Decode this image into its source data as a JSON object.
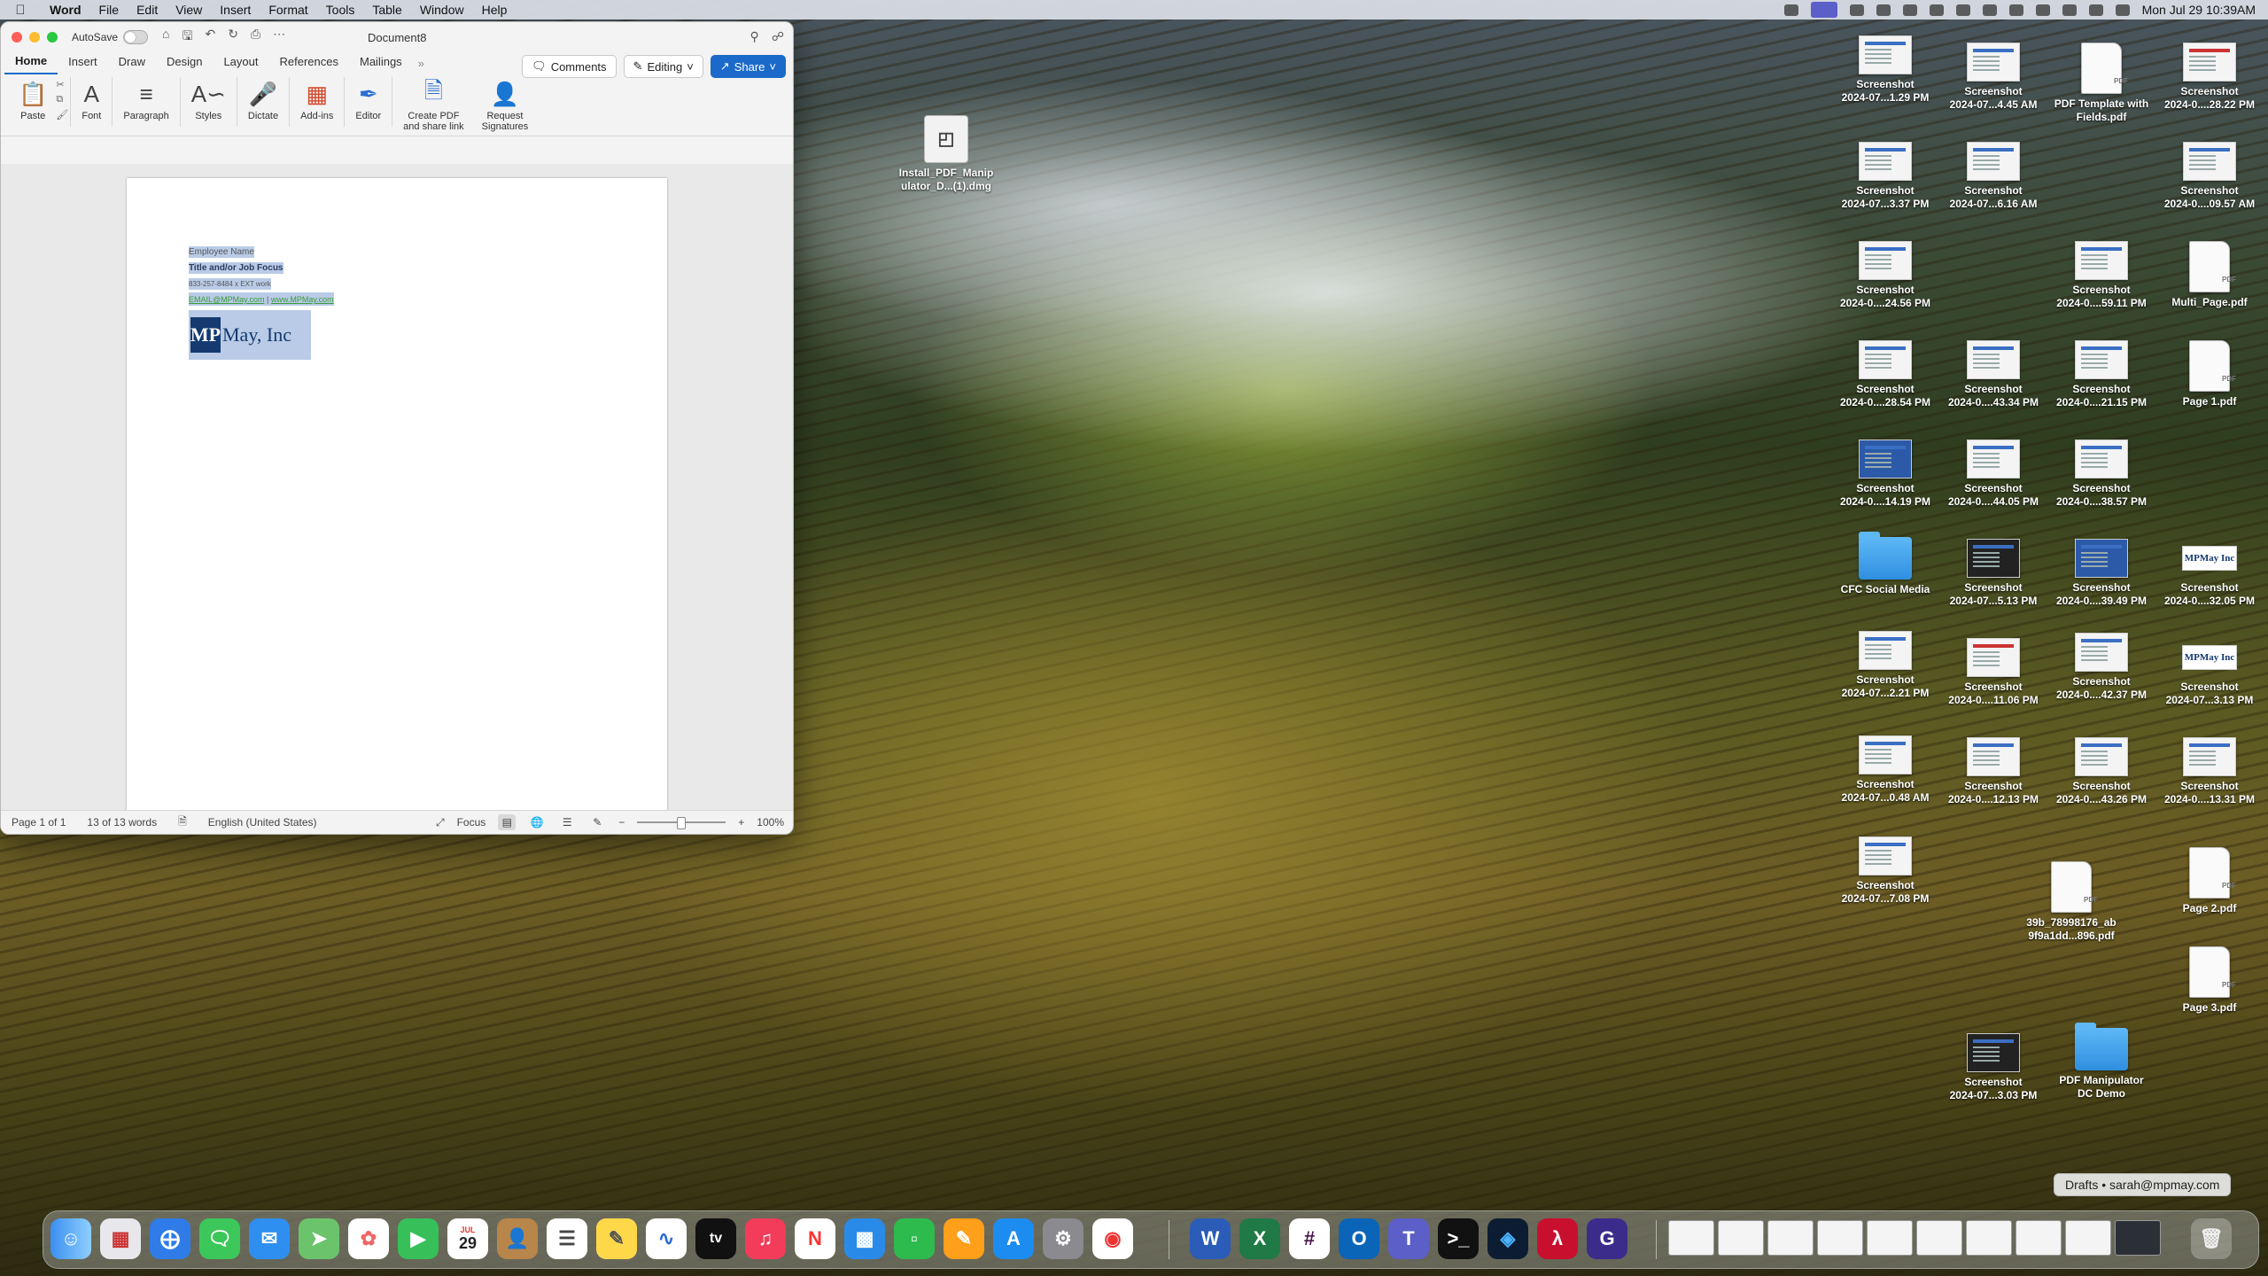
{
  "menubar": {
    "app": "Word",
    "items": [
      "File",
      "Edit",
      "View",
      "Insert",
      "Format",
      "Tools",
      "Table",
      "Window",
      "Help"
    ],
    "clock": "Mon Jul 29  10:39AM"
  },
  "word": {
    "autosave_label": "AutoSave",
    "doc_title": "Document8",
    "tabs": [
      "Home",
      "Insert",
      "Draw",
      "Design",
      "Layout",
      "References",
      "Mailings"
    ],
    "more_tabs": "»",
    "comments_label": "Comments",
    "editing_label": "Editing",
    "share_label": "Share",
    "ribbon": {
      "paste": "Paste",
      "font": "Font",
      "paragraph": "Paragraph",
      "styles": "Styles",
      "dictate": "Dictate",
      "addins": "Add-ins",
      "editor": "Editor",
      "create_pdf_1": "Create PDF",
      "create_pdf_2": "and share link",
      "request_sig_1": "Request",
      "request_sig_2": "Signatures"
    },
    "signature": {
      "name": "Employee Name",
      "title": "Title and/or Job Focus",
      "phone": "833-257-8484 x EXT work",
      "email": "EMAIL@MPMay.com",
      "separator": " | ",
      "web": "www.MPMay.com",
      "logo_mark": "MP",
      "logo_text": "May, Inc"
    },
    "status": {
      "page": "Page 1 of 1",
      "words": "13 of 13 words",
      "language": "English (United States)",
      "focus": "Focus",
      "zoom": "100%"
    }
  },
  "desktop": {
    "dmg": {
      "l1": "Install_PDF_Manip",
      "l2": "ulator_D...(1).dmg"
    },
    "col1": [
      {
        "l1": "Screenshot",
        "l2": "2024-07...1.29 PM"
      },
      {
        "l1": "Screenshot",
        "l2": "2024-07...3.37 PM"
      },
      {
        "l1": "Screenshot",
        "l2": "2024-0....24.56 PM"
      },
      {
        "l1": "Screenshot",
        "l2": "2024-0....28.54 PM"
      },
      {
        "l1": "Screenshot",
        "l2": "2024-0....14.19 PM"
      },
      {
        "l1": "CFC Social Media",
        "l2": ""
      },
      {
        "l1": "Screenshot",
        "l2": "2024-07...2.21 PM"
      },
      {
        "l1": "Screenshot",
        "l2": "2024-07...0.48 AM"
      },
      {
        "l1": "Screenshot",
        "l2": "2024-07...7.08 PM"
      }
    ],
    "col2": [
      {
        "l1": "Screenshot",
        "l2": "2024-07...4.45 AM"
      },
      {
        "l1": "Screenshot",
        "l2": "2024-07...6.16 AM"
      },
      {
        "l1": "Screenshot",
        "l2": "2024-0....43.34 PM"
      },
      {
        "l1": "Screenshot",
        "l2": "2024-0....44.05 PM"
      },
      {
        "l1": "Screenshot",
        "l2": "2024-07...5.13 PM"
      },
      {
        "l1": "Screenshot",
        "l2": "2024-0....11.06 PM"
      },
      {
        "l1": "Screenshot",
        "l2": "2024-0....12.13 PM"
      },
      {
        "l1": "Screenshot",
        "l2": "2024-07...3.03 PM"
      }
    ],
    "col3": [
      {
        "l1": "PDF Template with",
        "l2": "Fields.pdf"
      },
      {
        "l1": "Screenshot",
        "l2": "2024-0....59.11 PM"
      },
      {
        "l1": "Screenshot",
        "l2": "2024-0....21.15 PM"
      },
      {
        "l1": "Screenshot",
        "l2": "2024-0....38.57 PM"
      },
      {
        "l1": "Screenshot",
        "l2": "2024-0....39.49 PM"
      },
      {
        "l1": "Screenshot",
        "l2": "2024-0....42.37 PM"
      },
      {
        "l1": "Screenshot",
        "l2": "2024-0....43.26 PM"
      },
      {
        "l1": "39b_78998176_ab",
        "l2": "9f9a1dd...896.pdf"
      },
      {
        "l1": "PDF Manipulator",
        "l2": "DC Demo"
      }
    ],
    "col4": [
      {
        "l1": "Screenshot",
        "l2": "2024-0....28.22 PM"
      },
      {
        "l1": "Screenshot",
        "l2": "2024-0....09.57 AM"
      },
      {
        "l1": "Multi_Page.pdf",
        "l2": ""
      },
      {
        "l1": "Page 1.pdf",
        "l2": ""
      },
      {
        "l1": "Screenshot",
        "l2": "2024-0....32.05 PM"
      },
      {
        "l1": "Screenshot",
        "l2": "2024-07...3.13 PM"
      },
      {
        "l1": "Screenshot",
        "l2": "2024-0....13.31 PM"
      },
      {
        "l1": "Page 2.pdf",
        "l2": ""
      },
      {
        "l1": "Page 3.pdf",
        "l2": ""
      }
    ],
    "pdf_label": "PDF"
  },
  "dock": {
    "tooltip": "Drafts • sarah@mpmay.com",
    "calendar_month": "JUL",
    "calendar_day": "29",
    "tv_label": "tv"
  }
}
